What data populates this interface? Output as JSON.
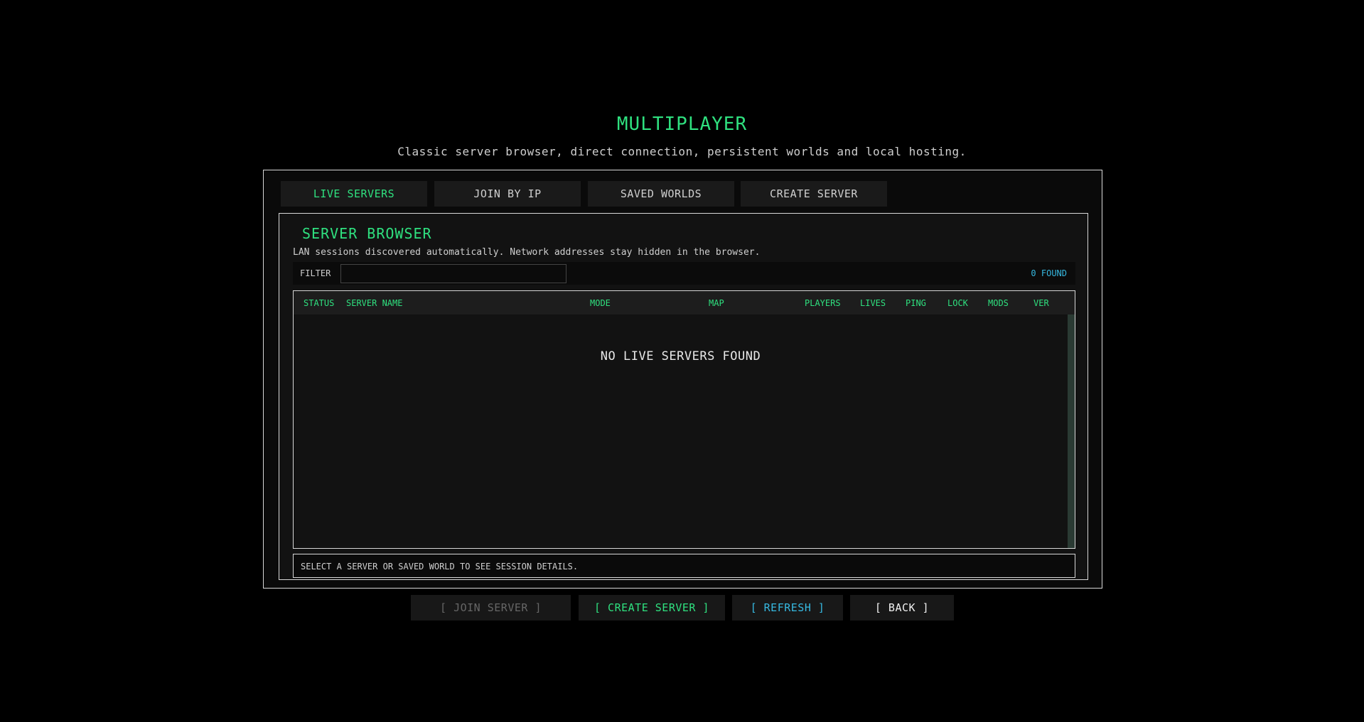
{
  "header": {
    "title": "MULTIPLAYER",
    "subtitle": "Classic server browser, direct connection, persistent worlds and local hosting."
  },
  "tabs": [
    {
      "label": "LIVE SERVERS",
      "active": true
    },
    {
      "label": "JOIN BY IP",
      "active": false
    },
    {
      "label": "SAVED WORLDS",
      "active": false
    },
    {
      "label": "CREATE SERVER",
      "active": false
    }
  ],
  "browser": {
    "title": "SERVER BROWSER",
    "description": "LAN sessions discovered automatically. Network addresses stay hidden in the browser.",
    "filter_label": "FILTER",
    "filter_value": "",
    "found_count": "0 FOUND",
    "columns": [
      "STATUS",
      "SERVER NAME",
      "MODE",
      "MAP",
      "PLAYERS",
      "LIVES",
      "PING",
      "LOCK",
      "MODS",
      "VER"
    ],
    "empty_message": "NO LIVE SERVERS FOUND",
    "details_hint": "SELECT A SERVER OR SAVED WORLD TO SEE SESSION DETAILS."
  },
  "actions": {
    "join": "[ JOIN SERVER ]",
    "create": "[ CREATE SERVER ]",
    "refresh": "[ REFRESH ]",
    "back": "[ BACK ]"
  },
  "colors": {
    "accent_green": "#2fe07f",
    "accent_blue": "#36b8e0",
    "disabled": "#666666"
  }
}
